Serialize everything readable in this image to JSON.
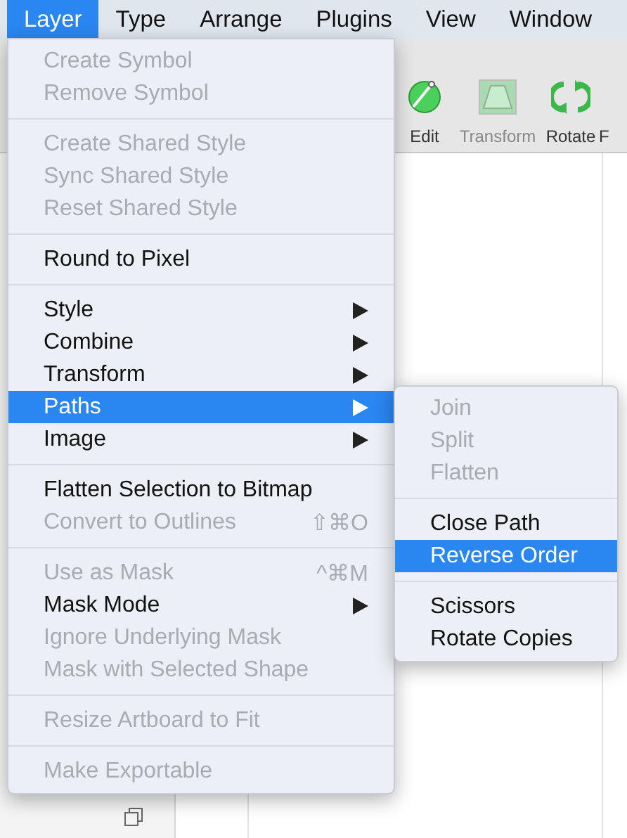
{
  "menubar": [
    {
      "label": "Layer",
      "selected": true
    },
    {
      "label": "Type",
      "selected": false
    },
    {
      "label": "Arrange",
      "selected": false
    },
    {
      "label": "Plugins",
      "selected": false
    },
    {
      "label": "View",
      "selected": false
    },
    {
      "label": "Window",
      "selected": false
    }
  ],
  "toolbar": [
    {
      "label": "Edit",
      "kind": "edit",
      "disabled": false
    },
    {
      "label": "Transform",
      "kind": "transform",
      "disabled": true
    },
    {
      "label": "Rotate",
      "kind": "rotate",
      "disabled": false
    },
    {
      "label": "F",
      "kind": "none",
      "disabled": false
    }
  ],
  "menu": {
    "sections": [
      [
        {
          "label": "Create Symbol",
          "disabled": true,
          "selected": false,
          "submenu": false
        },
        {
          "label": "Remove Symbol",
          "disabled": true,
          "selected": false,
          "submenu": false
        }
      ],
      [
        {
          "label": "Create Shared Style",
          "disabled": true,
          "selected": false,
          "submenu": false
        },
        {
          "label": "Sync Shared Style",
          "disabled": true,
          "selected": false,
          "submenu": false
        },
        {
          "label": "Reset Shared Style",
          "disabled": true,
          "selected": false,
          "submenu": false
        }
      ],
      [
        {
          "label": "Round to Pixel",
          "disabled": false,
          "selected": false,
          "submenu": false
        }
      ],
      [
        {
          "label": "Style",
          "disabled": false,
          "selected": false,
          "submenu": true
        },
        {
          "label": "Combine",
          "disabled": false,
          "selected": false,
          "submenu": true
        },
        {
          "label": "Transform",
          "disabled": false,
          "selected": false,
          "submenu": true
        },
        {
          "label": "Paths",
          "disabled": false,
          "selected": true,
          "submenu": true
        },
        {
          "label": "Image",
          "disabled": false,
          "selected": false,
          "submenu": true
        }
      ],
      [
        {
          "label": "Flatten Selection to Bitmap",
          "disabled": false,
          "selected": false,
          "submenu": false
        },
        {
          "label": "Convert to Outlines",
          "disabled": true,
          "selected": false,
          "submenu": false,
          "shortcut": "⇧⌘O"
        }
      ],
      [
        {
          "label": "Use as Mask",
          "disabled": true,
          "selected": false,
          "submenu": false,
          "shortcut": "^⌘M"
        },
        {
          "label": "Mask Mode",
          "disabled": false,
          "selected": false,
          "submenu": true
        },
        {
          "label": "Ignore Underlying Mask",
          "disabled": true,
          "selected": false,
          "submenu": false
        },
        {
          "label": "Mask with Selected Shape",
          "disabled": true,
          "selected": false,
          "submenu": false
        }
      ],
      [
        {
          "label": "Resize Artboard to Fit",
          "disabled": true,
          "selected": false,
          "submenu": false
        }
      ],
      [
        {
          "label": "Make Exportable",
          "disabled": true,
          "selected": false,
          "submenu": false
        }
      ]
    ]
  },
  "submenu": {
    "sections": [
      [
        {
          "label": "Join",
          "disabled": true,
          "selected": false
        },
        {
          "label": "Split",
          "disabled": true,
          "selected": false
        },
        {
          "label": "Flatten",
          "disabled": true,
          "selected": false
        }
      ],
      [
        {
          "label": "Close Path",
          "disabled": false,
          "selected": false
        },
        {
          "label": "Reverse Order",
          "disabled": false,
          "selected": true
        }
      ],
      [
        {
          "label": "Scissors",
          "disabled": false,
          "selected": false
        },
        {
          "label": "Rotate Copies",
          "disabled": false,
          "selected": false
        }
      ]
    ]
  }
}
